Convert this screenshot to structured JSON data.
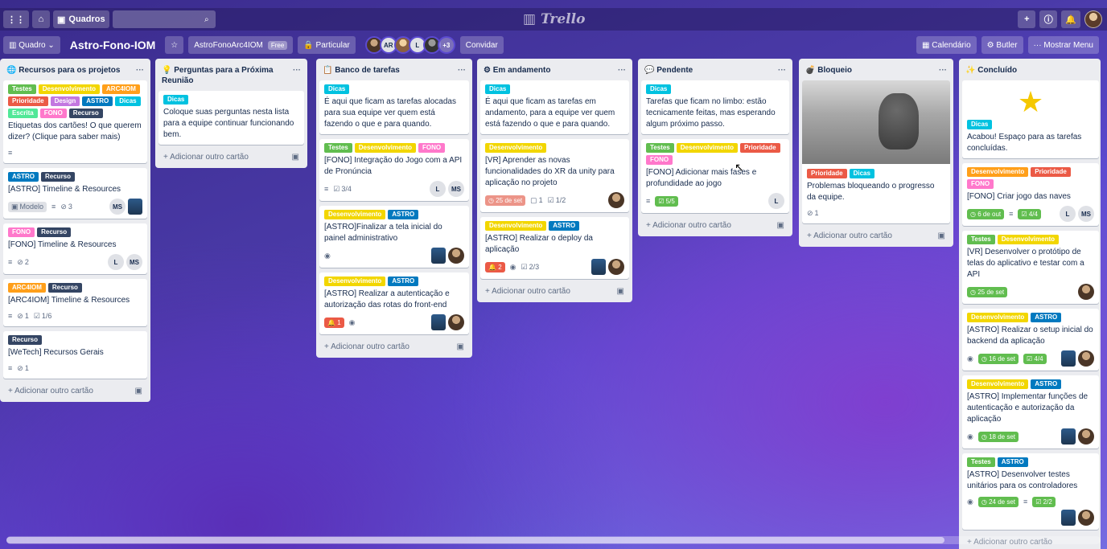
{
  "nav": {
    "search_icon": "search-icon",
    "logo": "Trello",
    "boards_label": "Quadros"
  },
  "board": {
    "view_label": "Quadro",
    "title": "Astro-Fono-IOM",
    "workspace": "AstroFonoArc4IOM",
    "plan": "Free",
    "visibility": "Particular",
    "extra_members": "+3",
    "member_initials": [
      "AR",
      "L"
    ],
    "invite": "Convidar",
    "calendar": "Calendário",
    "butler": "Butler",
    "show_menu": "Mostrar Menu"
  },
  "add_card_label": "Adicionar outro cartão",
  "lists": [
    {
      "title": "Recursos para os projetos"
    },
    {
      "title": "Perguntas para a Próxima Reunião"
    },
    {
      "title": "Banco de tarefas"
    },
    {
      "title": "Em andamento"
    },
    {
      "title": "Pendente"
    },
    {
      "title": "Bloqueio"
    },
    {
      "title": "Concluído"
    }
  ],
  "cards": {
    "r1": {
      "labels": [
        "Testes",
        "Desenvolvimento",
        "ARC4IOM",
        "Prioridade",
        "Design",
        "ASTRO",
        "Dicas",
        "Escrita",
        "FONO",
        "Recurso"
      ],
      "title": "Etiquetas dos cartões! O que querem dizer? (Clique para saber mais)"
    },
    "r2": {
      "labels": [
        "ASTRO",
        "Recurso"
      ],
      "title": "[ASTRO] Timeline & Resources",
      "template": "Modelo",
      "attach": "3",
      "member": "MS"
    },
    "r3": {
      "labels": [
        "FONO",
        "Recurso"
      ],
      "title": "[FONO] Timeline & Resources",
      "attach": "2",
      "m1": "L",
      "m2": "MS"
    },
    "r4": {
      "labels": [
        "ARC4IOM",
        "Recurso"
      ],
      "title": "[ARC4IOM] Timeline & Resources",
      "attach": "1",
      "check": "1/6"
    },
    "r5": {
      "labels": [
        "Recurso"
      ],
      "title": "[WeTech] Recursos Gerais",
      "attach": "1"
    },
    "p1": {
      "labels": [
        "Dicas"
      ],
      "title": "Coloque suas perguntas nesta lista para a equipe continuar funcionando bem."
    },
    "b1": {
      "labels": [
        "Dicas"
      ],
      "title": "É aqui que ficam as tarefas alocadas para sua equipe ver quem está fazendo o que e para quando."
    },
    "b2": {
      "labels": [
        "Testes",
        "Desenvolvimento",
        "FONO"
      ],
      "title": "[FONO] Integração do Jogo com a API de Pronúncia",
      "check": "3/4",
      "m1": "L",
      "m2": "MS"
    },
    "b3": {
      "labels": [
        "Desenvolvimento",
        "ASTRO"
      ],
      "title": "[ASTRO]Finalizar a tela inicial do painel administrativo"
    },
    "b4": {
      "labels": [
        "Desenvolvimento",
        "ASTRO"
      ],
      "title": "[ASTRO] Realizar a autenticação e autorização das rotas do front-end",
      "alert": "1"
    },
    "e1": {
      "labels": [
        "Dicas"
      ],
      "title": "É aqui que ficam as tarefas em andamento, para a equipe ver quem está fazendo o que e para quando."
    },
    "e2": {
      "labels": [
        "Desenvolvimento"
      ],
      "title": "[VR] Aprender as novas funcionalidades do XR da unity para aplicação no projeto",
      "due": "25 de set",
      "comments": "1",
      "check": "1/2"
    },
    "e3": {
      "labels": [
        "Desenvolvimento",
        "ASTRO"
      ],
      "title": "[ASTRO] Realizar o deploy da aplicação",
      "alert": "2",
      "check": "2/3"
    },
    "pe1": {
      "labels": [
        "Dicas"
      ],
      "title": "Tarefas que ficam no limbo: estão tecnicamente feitas, mas esperando algum próximo passo."
    },
    "pe2": {
      "labels": [
        "Testes",
        "Desenvolvimento",
        "Prioridade",
        "FONO"
      ],
      "title": "[FONO] Adicionar mais fases e profundidade ao jogo",
      "check": "5/5",
      "m1": "L"
    },
    "bl1": {
      "labels": [
        "Prioridade",
        "Dicas"
      ],
      "title": "Problemas bloqueando o progresso da equipe.",
      "attach": "1"
    },
    "c1": {
      "labels": [
        "Dicas"
      ],
      "title": "Acabou! Espaço para as tarefas concluídas."
    },
    "c2": {
      "labels": [
        "Desenvolvimento",
        "Prioridade",
        "FONO"
      ],
      "title": "[FONO] Criar jogo das naves",
      "due": "6 de out",
      "check": "4/4",
      "m1": "L",
      "m2": "MS"
    },
    "c3": {
      "labels": [
        "Testes",
        "Desenvolvimento"
      ],
      "title": "[VR] Desenvolver o protótipo de telas do aplicativo e testar com a API",
      "due": "25 de set"
    },
    "c4": {
      "labels": [
        "Desenvolvimento",
        "ASTRO"
      ],
      "title": "[ASTRO] Realizar o setup inicial do backend da aplicação",
      "due": "16 de set",
      "check": "4/4"
    },
    "c5": {
      "labels": [
        "Desenvolvimento",
        "ASTRO"
      ],
      "title": "[ASTRO] Implementar funções de autenticação e autorização da aplicação",
      "due": "18 de set"
    },
    "c6": {
      "labels": [
        "Testes",
        "ASTRO"
      ],
      "title": "[ASTRO] Desenvolver testes unitários para os controladores",
      "due": "24 de set",
      "check": "2/2"
    }
  }
}
